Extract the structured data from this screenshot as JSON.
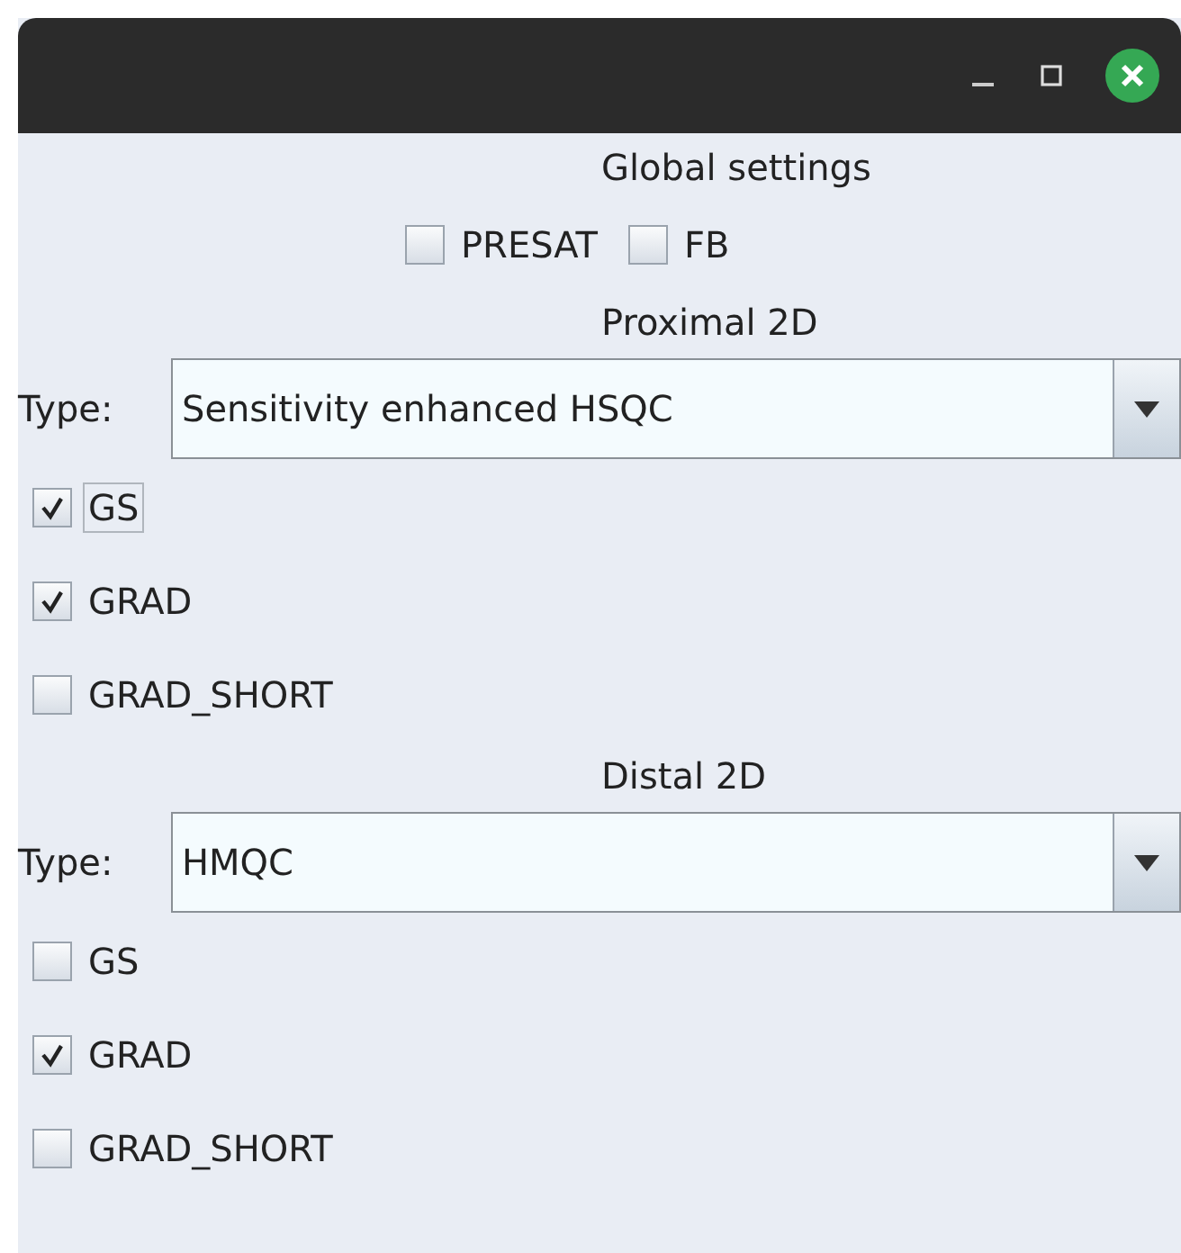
{
  "window": {
    "controls": [
      {
        "kind": "minimize"
      },
      {
        "kind": "maximize"
      },
      {
        "kind": "close"
      }
    ]
  },
  "global": {
    "title": "Global settings",
    "options": [
      {
        "label": "PRESAT",
        "checked": false
      },
      {
        "label": "FB",
        "checked": false
      }
    ]
  },
  "sections": [
    {
      "title": "Proximal 2D",
      "type_label": "Type:",
      "type_value": "Sensitivity enhanced HSQC",
      "options": [
        {
          "label": "GS",
          "checked": true,
          "focused": true
        },
        {
          "label": "GRAD",
          "checked": true,
          "focused": false
        },
        {
          "label": "GRAD_SHORT",
          "checked": false,
          "focused": false
        }
      ]
    },
    {
      "title": "Distal 2D",
      "type_label": "Type:",
      "type_value": "HMQC",
      "options": [
        {
          "label": "GS",
          "checked": false,
          "focused": false
        },
        {
          "label": "GRAD",
          "checked": true,
          "focused": false
        },
        {
          "label": "GRAD_SHORT",
          "checked": false,
          "focused": false
        }
      ]
    }
  ]
}
